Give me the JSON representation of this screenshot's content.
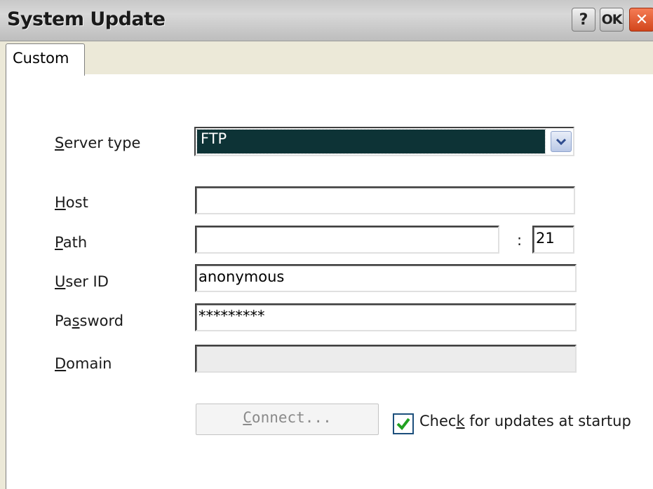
{
  "window": {
    "title": "System Update",
    "help_button": "?",
    "ok_button": "OK",
    "close_button": "✕"
  },
  "tabs": [
    {
      "label": "Custom",
      "selected": true
    }
  ],
  "form": {
    "server_type": {
      "label_underline": "S",
      "label_rest": "erver type",
      "value": "FTP",
      "arrow": "chevron-down-icon"
    },
    "host": {
      "label_underline": "H",
      "label_rest": "ost",
      "value": ""
    },
    "path": {
      "label_underline": "P",
      "label_rest": "ath",
      "value": ""
    },
    "port": {
      "separator": ":",
      "value": "21"
    },
    "user_id": {
      "label_underline": "U",
      "label_rest": "ser ID",
      "value": "anonymous"
    },
    "password": {
      "label_pre": "Pa",
      "label_underline": "s",
      "label_rest": "sword",
      "value": "*********"
    },
    "domain": {
      "label_underline": "D",
      "label_rest": "omain",
      "value": "",
      "enabled": false
    }
  },
  "connect_button": {
    "label_underline": "C",
    "label_rest": "onnect...",
    "enabled": false
  },
  "startup_check": {
    "label_pre": "Chec",
    "label_underline": "k",
    "label_rest": " for updates at startup",
    "checked": true
  },
  "colors": {
    "selection": "#0d3336",
    "check": "#21a121",
    "close": "#d2461c"
  }
}
